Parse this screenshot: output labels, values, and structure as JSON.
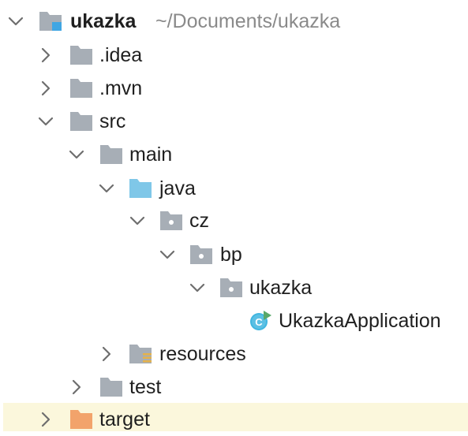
{
  "project_tree": {
    "root": {
      "name": "ukazka",
      "path": "~/Documents/ukazka",
      "expanded": true
    },
    "idea": {
      "name": ".idea",
      "expanded": false
    },
    "mvn": {
      "name": ".mvn",
      "expanded": false
    },
    "src": {
      "name": "src",
      "expanded": true
    },
    "main": {
      "name": "main",
      "expanded": true
    },
    "java": {
      "name": "java",
      "expanded": true
    },
    "cz": {
      "name": "cz",
      "expanded": true
    },
    "bp": {
      "name": "bp",
      "expanded": true
    },
    "ukazka_pkg": {
      "name": "ukazka",
      "expanded": true
    },
    "app_class": {
      "name": "UkazkaApplication",
      "icon": "spring-boot-class-icon"
    },
    "resources": {
      "name": "resources",
      "expanded": false
    },
    "test": {
      "name": "test",
      "expanded": false
    },
    "target": {
      "name": "target",
      "expanded": false,
      "highlighted": true
    }
  },
  "colors": {
    "folder_gray": "#a7aeb6",
    "folder_source_blue": "#7fc7e8",
    "folder_excluded_orange": "#f2a36b",
    "module_marker_blue": "#40a6e3",
    "class_circle": "#40b6e0",
    "run_marker_green": "#59a869",
    "row_highlight": "#fbf7dc",
    "path_text": "#8a8a8a"
  }
}
